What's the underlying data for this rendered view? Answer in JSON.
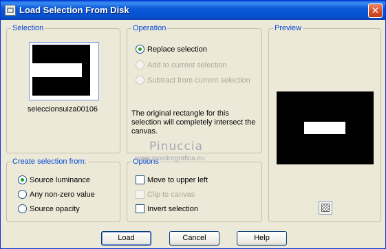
{
  "window": {
    "title": "Load Selection From Disk",
    "close_glyph": "✕"
  },
  "selection": {
    "legend": "Selection",
    "file_name": "seleccionsuiza00106"
  },
  "operation": {
    "legend": "Operation",
    "options": [
      {
        "label": "Replace selection",
        "checked": true,
        "enabled": true
      },
      {
        "label": "Add to current selection",
        "checked": false,
        "enabled": false
      },
      {
        "label": "Subtract from current selection",
        "checked": false,
        "enabled": false
      }
    ],
    "info": "The original rectangle for this selection will completely intersect the canvas."
  },
  "preview": {
    "legend": "Preview"
  },
  "create_from": {
    "legend": "Create selection from:",
    "options": [
      {
        "label": "Source luminance",
        "checked": true
      },
      {
        "label": "Any non-zero value",
        "checked": false
      },
      {
        "label": "Source opacity",
        "checked": false
      }
    ]
  },
  "options": {
    "legend": "Options",
    "items": [
      {
        "label": "Move to upper left",
        "checked": false,
        "enabled": true
      },
      {
        "label": "Clip to canvas",
        "checked": false,
        "enabled": false
      },
      {
        "label": "Invert selection",
        "checked": false,
        "enabled": true
      }
    ]
  },
  "watermark": {
    "name": "Pinuccia",
    "url": "www.moidiregrafica.eu"
  },
  "buttons": {
    "load": "Load",
    "cancel": "Cancel",
    "help": "Help"
  },
  "colors": {
    "accent": "#0046d5",
    "titlebar": "#0a5ad8",
    "radio_dot": "#21a121"
  },
  "icons": {
    "app": "selection-app-icon",
    "close": "close-icon",
    "preview_toggle": "checkerboard-icon"
  }
}
